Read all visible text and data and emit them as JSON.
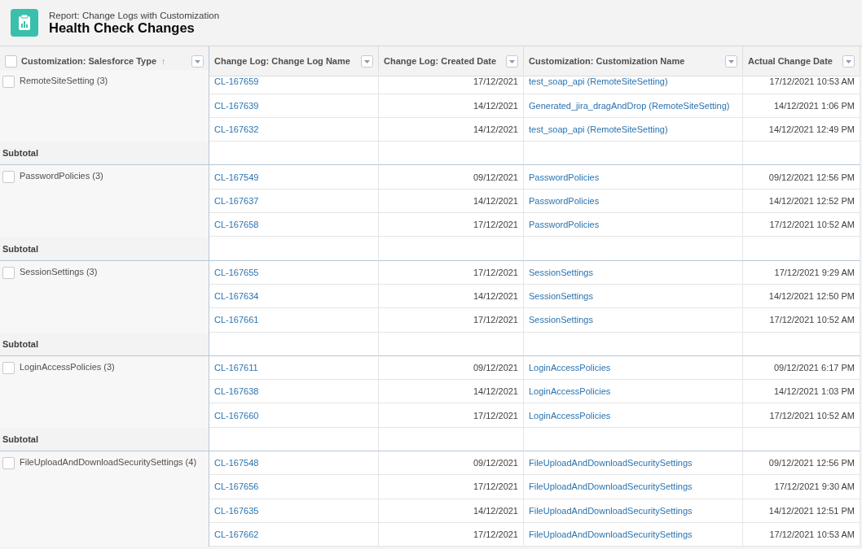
{
  "header": {
    "subtitle": "Report: Change Logs with Customization",
    "title": "Health Check Changes"
  },
  "table": {
    "columns": [
      {
        "label": "Customization: Salesforce Type",
        "sort": "↑"
      },
      {
        "label": "Change Log: Change Log Name"
      },
      {
        "label": "Change Log: Created Date"
      },
      {
        "label": "Customization: Customization Name"
      },
      {
        "label": "Actual Change Date"
      }
    ],
    "select_all": {
      "checked": false
    },
    "groups": [
      {
        "label": "RemoteSiteSetting (3)",
        "checked": false,
        "subtotal": "Subtotal",
        "rows": [
          {
            "name": "CL-167659",
            "created": "17/12/2021",
            "customization": "test_soap_api (RemoteSiteSetting)",
            "actual": "17/12/2021 10:53 AM"
          },
          {
            "name": "CL-167639",
            "created": "14/12/2021",
            "customization": "Generated_jira_dragAndDrop (RemoteSiteSetting)",
            "actual": "14/12/2021 1:06 PM"
          },
          {
            "name": "CL-167632",
            "created": "14/12/2021",
            "customization": "test_soap_api (RemoteSiteSetting)",
            "actual": "14/12/2021 12:49 PM"
          }
        ]
      },
      {
        "label": "PasswordPolicies (3)",
        "checked": false,
        "subtotal": "Subtotal",
        "rows": [
          {
            "name": "CL-167549",
            "created": "09/12/2021",
            "customization": "PasswordPolicies",
            "actual": "09/12/2021 12:56 PM"
          },
          {
            "name": "CL-167637",
            "created": "14/12/2021",
            "customization": "PasswordPolicies",
            "actual": "14/12/2021 12:52 PM"
          },
          {
            "name": "CL-167658",
            "created": "17/12/2021",
            "customization": "PasswordPolicies",
            "actual": "17/12/2021 10:52 AM"
          }
        ]
      },
      {
        "label": "SessionSettings (3)",
        "checked": false,
        "subtotal": "Subtotal",
        "rows": [
          {
            "name": "CL-167655",
            "created": "17/12/2021",
            "customization": "SessionSettings",
            "actual": "17/12/2021 9:29 AM"
          },
          {
            "name": "CL-167634",
            "created": "14/12/2021",
            "customization": "SessionSettings",
            "actual": "14/12/2021 12:50 PM"
          },
          {
            "name": "CL-167661",
            "created": "17/12/2021",
            "customization": "SessionSettings",
            "actual": "17/12/2021 10:52 AM"
          }
        ]
      },
      {
        "label": "LoginAccessPolicies (3)",
        "checked": false,
        "subtotal": "Subtotal",
        "rows": [
          {
            "name": "CL-167611",
            "created": "09/12/2021",
            "customization": "LoginAccessPolicies",
            "actual": "09/12/2021 6:17 PM"
          },
          {
            "name": "CL-167638",
            "created": "14/12/2021",
            "customization": "LoginAccessPolicies",
            "actual": "14/12/2021 1:03 PM"
          },
          {
            "name": "CL-167660",
            "created": "17/12/2021",
            "customization": "LoginAccessPolicies",
            "actual": "17/12/2021 10:52 AM"
          }
        ]
      },
      {
        "label": "FileUploadAndDownloadSecuritySettings (4)",
        "checked": false,
        "rows": [
          {
            "name": "CL-167548",
            "created": "09/12/2021",
            "customization": "FileUploadAndDownloadSecuritySettings",
            "actual": "09/12/2021 12:56 PM"
          },
          {
            "name": "CL-167656",
            "created": "17/12/2021",
            "customization": "FileUploadAndDownloadSecuritySettings",
            "actual": "17/12/2021 9:30 AM"
          },
          {
            "name": "CL-167635",
            "created": "14/12/2021",
            "customization": "FileUploadAndDownloadSecuritySettings",
            "actual": "14/12/2021 12:51 PM"
          },
          {
            "name": "CL-167662",
            "created": "17/12/2021",
            "customization": "FileUploadAndDownloadSecuritySettings",
            "actual": "17/12/2021 10:53 AM"
          }
        ]
      }
    ]
  }
}
